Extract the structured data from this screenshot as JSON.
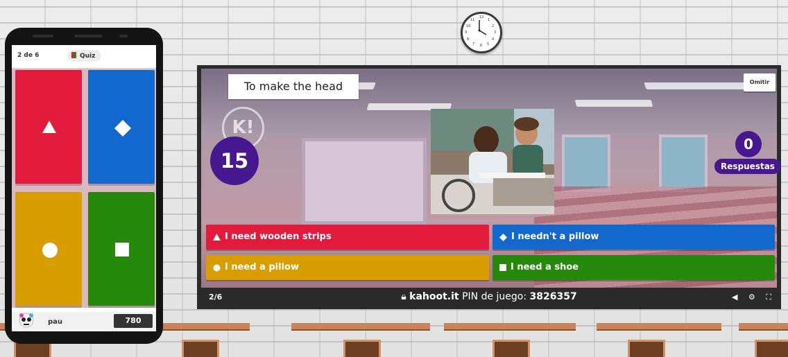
{
  "phone": {
    "question_counter": "2 de 6",
    "quiz_label": "Quiz",
    "player_name": "pau",
    "player_score": "780",
    "tile_colors": [
      "#e21b3c",
      "#1368ce",
      "#d89e00",
      "#26890c"
    ]
  },
  "game": {
    "title": "To make the head",
    "skip_label": "Omitir",
    "timer": "15",
    "answers_count": "0",
    "answers_label": "Respuestas",
    "answers": [
      {
        "shape": "triangle-icon",
        "text": "I need wooden strips",
        "color": "#e21b3c"
      },
      {
        "shape": "diamond-icon",
        "text": "I needn't a pillow",
        "color": "#1368ce"
      },
      {
        "shape": "circle-icon",
        "text": "I need a pillow",
        "color": "#d89e00"
      },
      {
        "shape": "square-icon",
        "text": "I need a shoe",
        "color": "#26890c"
      }
    ]
  },
  "bottom_bar": {
    "progress": "2/6",
    "site": "kahoot.it",
    "pin_label": "PIN de juego:",
    "pin": "3826357"
  },
  "clock_numbers": [
    "12",
    "1",
    "2",
    "3",
    "4",
    "5",
    "6",
    "7",
    "8",
    "9",
    "10",
    "11"
  ]
}
